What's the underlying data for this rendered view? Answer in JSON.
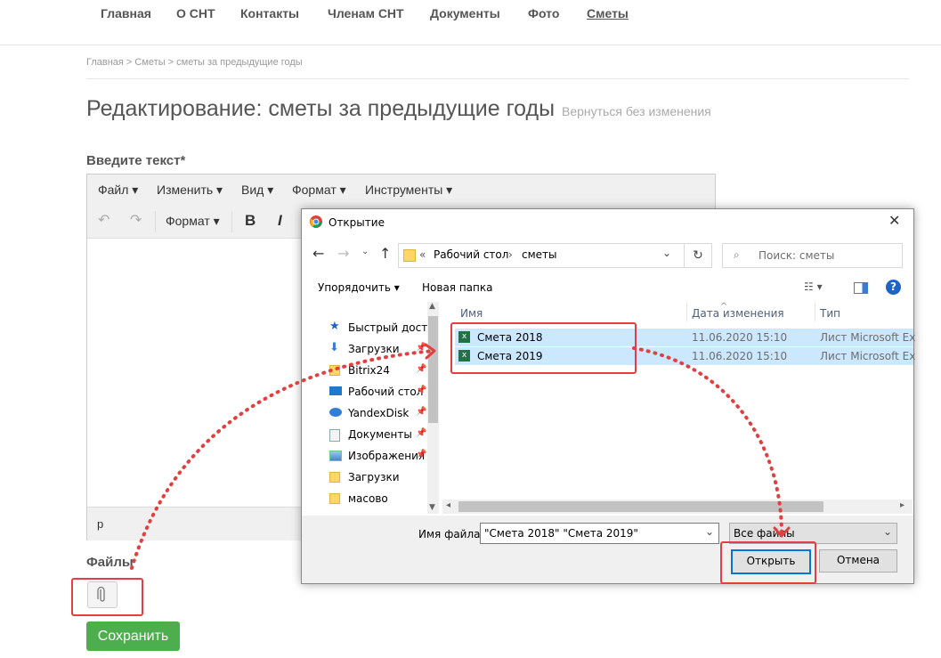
{
  "nav": {
    "items": [
      "Главная",
      "О СНТ",
      "Контакты",
      "Членам СНТ",
      "Документы",
      "Фото",
      "Сметы"
    ]
  },
  "breadcrumb": "Главная > Сметы > сметы за предыдущие годы",
  "page": {
    "title": "Редактирование: сметы за предыдущие годы",
    "back_link": "Вернуться без изменения",
    "text_label": "Введите текст*",
    "files_label": "Файлы",
    "save_label": "Сохранить"
  },
  "editor": {
    "menus": [
      "Файл",
      "Изменить",
      "Вид",
      "Формат",
      "Инструменты"
    ],
    "toolbar": {
      "format_label": "Формат",
      "bold": "B",
      "italic": "I"
    },
    "status_path": "p"
  },
  "dialog": {
    "title": "Открытие",
    "path_prefix": "«",
    "path": [
      "Рабочий стол",
      "сметы"
    ],
    "search_placeholder": "Поиск: сметы",
    "organize_label": "Упорядочить",
    "new_folder_label": "Новая папка",
    "nav_items": [
      {
        "label": "Быстрый доступ",
        "icon": "star-icon"
      },
      {
        "label": "Загрузки",
        "icon": "download-icon",
        "pinned": true
      },
      {
        "label": "Bitrix24",
        "icon": "folder-icon",
        "pinned": true
      },
      {
        "label": "Рабочий стол",
        "icon": "desktop-icon",
        "pinned": true
      },
      {
        "label": "YandexDisk",
        "icon": "yandex-disk-icon",
        "pinned": true
      },
      {
        "label": "Документы",
        "icon": "documents-icon",
        "pinned": true
      },
      {
        "label": "Изображения",
        "icon": "images-icon",
        "pinned": true
      },
      {
        "label": "Загрузки",
        "icon": "folder-icon"
      },
      {
        "label": "масово",
        "icon": "folder-icon"
      }
    ],
    "columns": [
      "Имя",
      "Дата изменения",
      "Тип"
    ],
    "files": [
      {
        "name": "Смета 2018",
        "date": "11.06.2020 15:10",
        "type": "Лист Microsoft Ex"
      },
      {
        "name": "Смета 2019",
        "date": "11.06.2020 15:10",
        "type": "Лист Microsoft Ex"
      }
    ],
    "filename_label": "Имя файла:",
    "filename_value": "\"Смета 2018\" \"Смета 2019\"",
    "filter_value": "Все файлы",
    "open_label": "Открыть",
    "cancel_label": "Отмена"
  },
  "colors": {
    "highlight": "#e04040",
    "save_button": "#4cae4c",
    "selection": "#cce8ff"
  }
}
